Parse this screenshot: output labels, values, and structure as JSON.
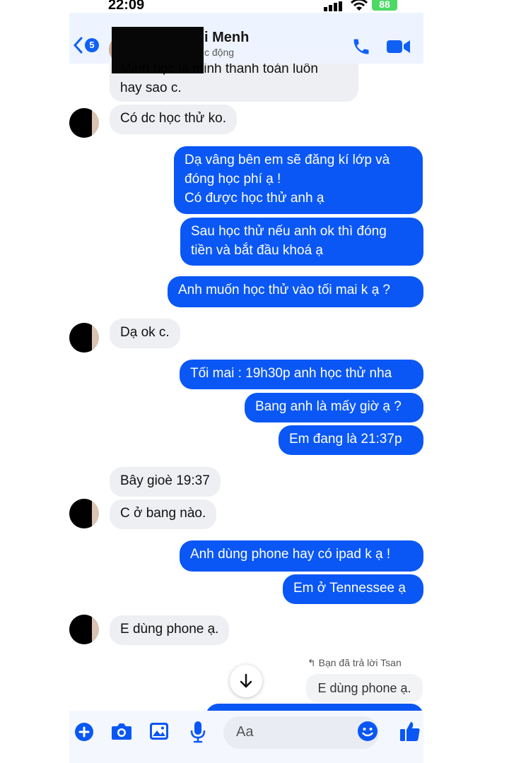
{
  "status_bar": {
    "time": "22:09",
    "battery": "88"
  },
  "header": {
    "badge": "5",
    "name": "i Menh",
    "status": "c động"
  },
  "messages": [
    {
      "dir": "in",
      "text": "Minh học là minh thanh toán luôn\nhay sao c."
    },
    {
      "dir": "in",
      "text": "Có dc học thử ko."
    },
    {
      "dir": "out",
      "text": "Dạ vâng bên em sẽ đăng kí lớp và\nđóng học phí ạ !\nCó được học thử anh ạ"
    },
    {
      "dir": "out",
      "text": "Sau học thử nếu anh ok thì đóng\ntiền và bắt đầu khoá ạ"
    },
    {
      "dir": "out",
      "text": "Anh muốn học thử vào tối mai k ạ ?"
    },
    {
      "dir": "in",
      "text": "Dạ ok c."
    },
    {
      "dir": "out",
      "text": "Tối mai : 19h30p anh học thử nha"
    },
    {
      "dir": "out",
      "text": "Bang anh là mấy giờ ạ ?"
    },
    {
      "dir": "out",
      "text": "Em đang là 21:37p"
    },
    {
      "dir": "in",
      "text": "Bây gioè 19:37"
    },
    {
      "dir": "in",
      "text": "C ở bang nào."
    },
    {
      "dir": "out",
      "text": "Anh dùng phone hay có ipad k ạ !"
    },
    {
      "dir": "out",
      "text": "Em ở Tennessee ạ"
    },
    {
      "dir": "in",
      "text": "E dùng phone ạ."
    }
  ],
  "reply": {
    "note": "Bạn đã trả lời Tsan",
    "quoted": "E dùng phone ạ."
  },
  "composer": {
    "placeholder": "Aa"
  },
  "colors": {
    "accent": "#0a57f5",
    "incoming_bg": "#eeeff2"
  }
}
